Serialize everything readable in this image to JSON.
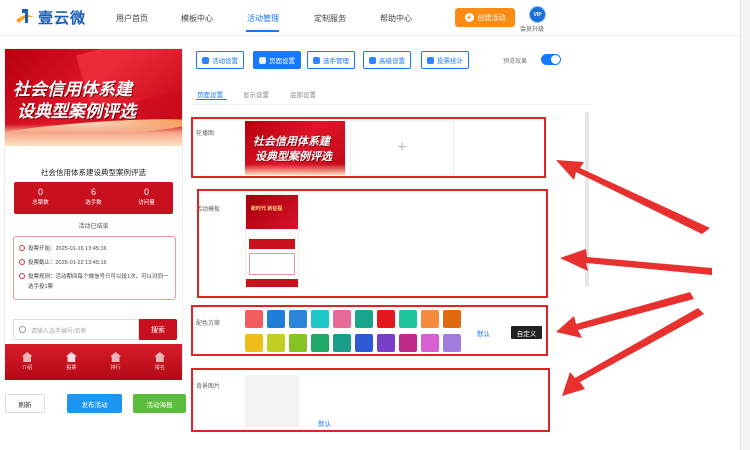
{
  "header": {
    "logo_text": "壹云微",
    "nav": [
      "用户首页",
      "模板中心",
      "活动管理",
      "定制服务",
      "帮助中心"
    ],
    "active_nav": "活动管理",
    "create_button": "创建活动",
    "vip_badge": "VIP",
    "vip_label": "会员升级"
  },
  "preview": {
    "banner_line1": "社会信用体系建",
    "banner_line2": "设典型案例评选",
    "title": "社会信用体系建设典型案例评选",
    "stats": [
      {
        "value": "0",
        "label": "总票数"
      },
      {
        "value": "6",
        "label": "选手数"
      },
      {
        "value": "0",
        "label": "访问量"
      }
    ],
    "status": "活动已结束",
    "rules": [
      "投票开始：2025-01-16 13:45:16",
      "投票截止：2025-01-22 13:45:16",
      "投票规则：活动期间每个微信号只可以投1次，可以对同一选手投1票"
    ],
    "search_placeholder": "请输入选手编号/名称",
    "search_button": "搜索",
    "tabbar": [
      "介绍",
      "投票",
      "排行",
      "报名"
    ],
    "tabbar_active": "投票"
  },
  "bottom_buttons": {
    "refresh": "刷新",
    "publish": "发布活动",
    "poster": "活动海报"
  },
  "toolbar": {
    "tabs": [
      "活动设置",
      "页面设置",
      "选手管理",
      "高级设置",
      "投票统计"
    ],
    "active_tab": "页面设置",
    "preview_label": "预览效果",
    "preview_enabled": true
  },
  "subtabs": {
    "items": [
      "页面设置",
      "显示设置",
      "底部设置"
    ],
    "active": "页面设置"
  },
  "sections": {
    "carousel_label": "轮播图",
    "template_label": "活动模板",
    "template_thumb_text": "新时代 新征程",
    "color_label": "配色方案",
    "color_default": "默认",
    "color_custom": "自定义",
    "bg_label": "背景图片",
    "bg_default": "默认"
  },
  "palette": {
    "row1": [
      "#f25c5c",
      "#1f7fd8",
      "#2b86d9",
      "#1ec8c8",
      "#e86a97",
      "#1aa58d",
      "#e4191e",
      "#1ec79b",
      "#f68b3e",
      "#e06a12"
    ],
    "row2": [
      "#f0bd1a",
      "#c1cf21",
      "#87c224",
      "#1fa868",
      "#1a9e8a",
      "#2d5bd6",
      "#7a3fc9",
      "#c02a8d",
      "#d85fd0",
      "#a07ce0"
    ]
  },
  "colors": {
    "accent": "#1677ff",
    "brand_red": "#c8101e",
    "annotation_red": "#e02424",
    "create_orange": "#fa8c16"
  }
}
